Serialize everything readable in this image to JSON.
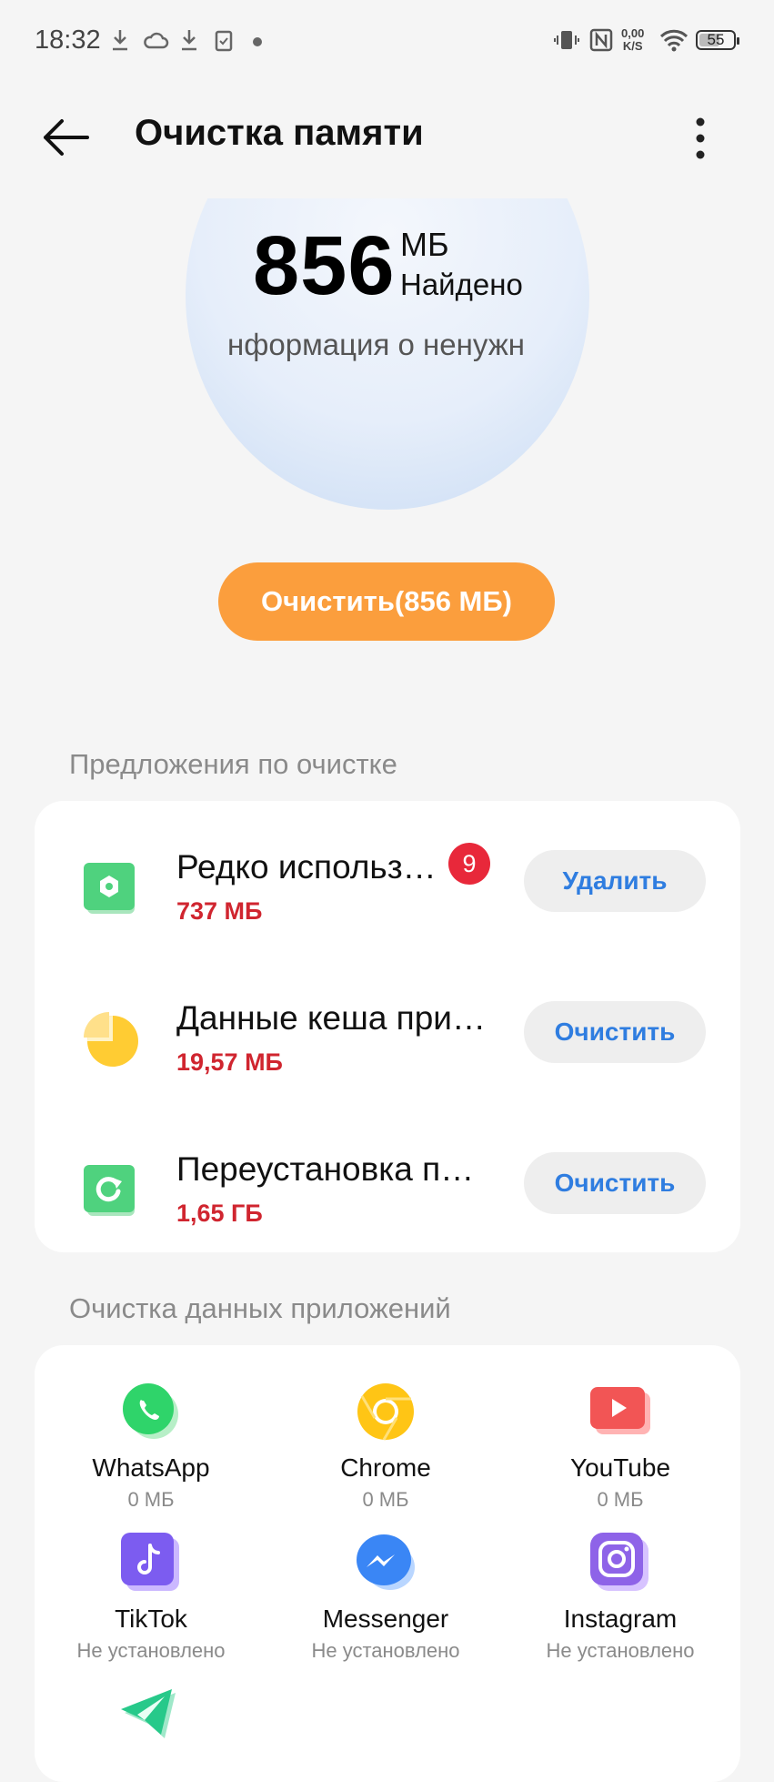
{
  "status_bar": {
    "time": "18:32",
    "speed_value": "0,00",
    "speed_unit": "K/S",
    "battery": "55",
    "battery_level": 0.55
  },
  "header": {
    "title": "Очистка памяти"
  },
  "summary": {
    "amount": "856",
    "unit": "МБ",
    "found_label": "Найдено",
    "subtitle": "нформация о ненужн"
  },
  "clean_button": {
    "label": "Очистить(856 МБ)",
    "color": "#fb9e3d"
  },
  "suggestions": {
    "section_title": "Предложения по очистке",
    "items": [
      {
        "title": "Редко использ…",
        "size": "737 МБ",
        "badge": "9",
        "action": "Удалить",
        "icon": "rarely-used-apps-icon"
      },
      {
        "title": "Данные кеша при…",
        "size": "19,57 МБ",
        "action": "Очистить",
        "icon": "cache-pie-icon"
      },
      {
        "title": "Переустановка п…",
        "size": "1,65 ГБ",
        "action": "Очистить",
        "icon": "reinstall-package-icon"
      }
    ]
  },
  "app_cleaning": {
    "section_title": "Очистка данных приложений",
    "apps": [
      {
        "name": "WhatsApp",
        "size": "0 МБ",
        "icon": "whatsapp-icon"
      },
      {
        "name": "Chrome",
        "size": "0 МБ",
        "icon": "chrome-icon"
      },
      {
        "name": "YouTube",
        "size": "0 МБ",
        "icon": "youtube-icon"
      },
      {
        "name": "TikTok",
        "size": "Не установлено",
        "icon": "tiktok-icon"
      },
      {
        "name": "Messenger",
        "size": "Не установлено",
        "icon": "messenger-icon"
      },
      {
        "name": "Instagram",
        "size": "Не установлено",
        "icon": "instagram-icon"
      },
      {
        "name": "",
        "size": "",
        "icon": "telegram-icon"
      }
    ]
  },
  "colors": {
    "accent_blue": "#2f7de0",
    "size_red": "#d0252f",
    "badge_red": "#e8283a"
  }
}
